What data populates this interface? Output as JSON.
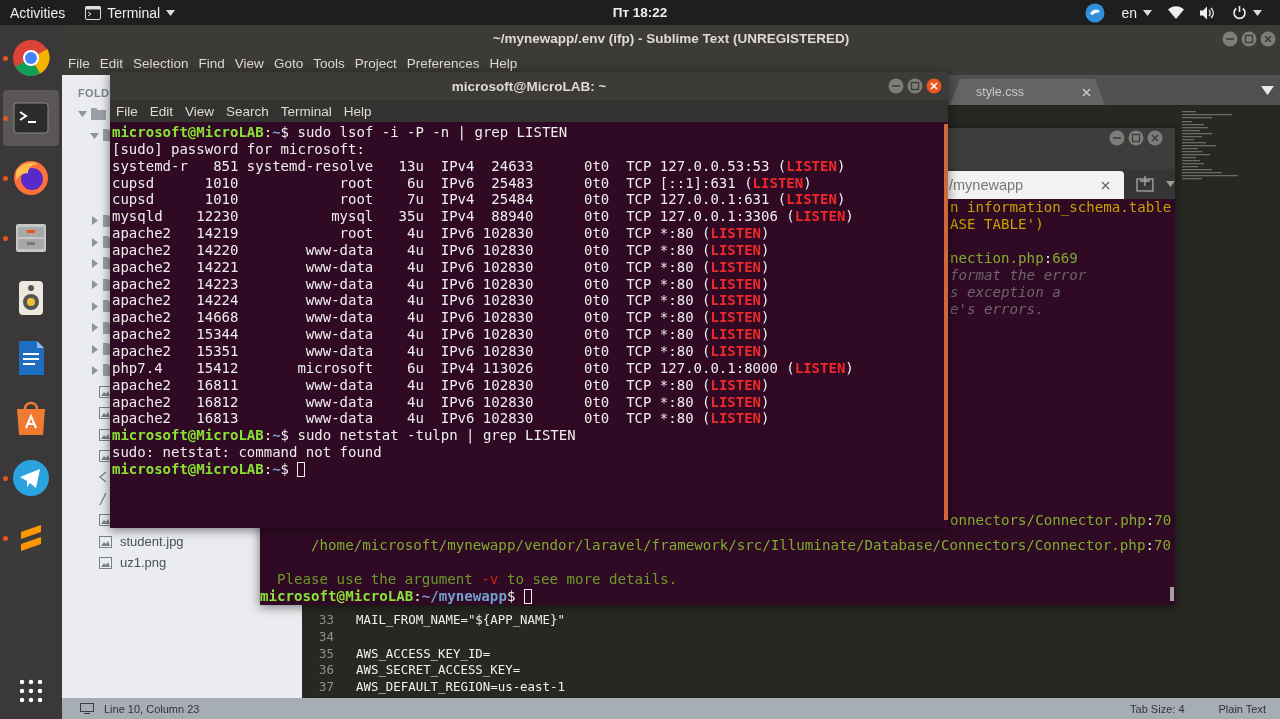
{
  "top_bar": {
    "activities": "Activities",
    "app_menu": "Terminal",
    "clock": "Пт 18:22",
    "keyboard_layout": "en"
  },
  "dock": {
    "items": [
      {
        "kind": "browser",
        "selected": false,
        "running": true
      },
      {
        "kind": "terminal",
        "selected": true,
        "running": true
      },
      {
        "kind": "fox",
        "selected": false,
        "running": true
      },
      {
        "kind": "files",
        "selected": false,
        "running": true
      },
      {
        "kind": "music",
        "selected": false,
        "running": false
      },
      {
        "kind": "document",
        "selected": false,
        "running": false
      },
      {
        "kind": "store",
        "selected": false,
        "running": false
      },
      {
        "kind": "messenger",
        "selected": false,
        "running": true
      },
      {
        "kind": "editor",
        "selected": false,
        "running": true
      }
    ],
    "apps_button": {
      "kind": "apps"
    }
  },
  "editor_window": {
    "title": "~/mynewapp/.env (ifp) - Sublime Text (UNREGISTERED)",
    "menu": [
      "File",
      "Edit",
      "Selection",
      "Find",
      "View",
      "Goto",
      "Tools",
      "Project",
      "Preferences",
      "Help"
    ],
    "sidebar": {
      "header": "FOLD",
      "tree": [
        {
          "kind": "folder",
          "expanded": true,
          "children": [
            {
              "kind": "folder",
              "expanded": true
            },
            {
              "kind": "folder",
              "expanded": false
            },
            {
              "kind": "folder",
              "expanded": false
            },
            {
              "kind": "folder",
              "expanded": false
            },
            {
              "kind": "folder",
              "expanded": false
            },
            {
              "kind": "folder",
              "expanded": false
            },
            {
              "kind": "folder",
              "expanded": false
            },
            {
              "kind": "folder",
              "expanded": false
            },
            {
              "kind": "folder",
              "expanded": false
            },
            {
              "kind": "image"
            },
            {
              "kind": "image"
            },
            {
              "kind": "image"
            },
            {
              "kind": "image"
            },
            {
              "kind": "markup"
            },
            {
              "kind": "script"
            },
            {
              "kind": "image"
            },
            {
              "kind": "image",
              "name": "student.jpg"
            },
            {
              "kind": "image",
              "name": "uz1.png"
            }
          ]
        }
      ]
    },
    "tabs": [
      {
        "label": "style.css",
        "selected": false
      }
    ],
    "lines": [
      {
        "number": "33",
        "text": "MAIL_FROM_NAME=\"${APP_NAME}\""
      },
      {
        "number": "34"
      },
      {
        "number": "35",
        "text": "AWS_ACCESS_KEY_ID="
      },
      {
        "number": "36",
        "text": "AWS_SECRET_ACCESS_KEY="
      },
      {
        "number": "37",
        "text": "AWS_DEFAULT_REGION=us-east-1"
      }
    ],
    "status_bar": {
      "position": "Line 10, Column 23",
      "tab_size": "Tab Size: 4",
      "syntax": "Plain Text"
    }
  },
  "back_terminal": {
    "tab": {
      "label": "/mynewapp"
    },
    "fragment_groups": [
      {
        "lines": [
          {
            "segments": [
              {
                "kind": "string",
                "text": "n information_schema.table"
              }
            ]
          },
          {
            "segments": [
              {
                "kind": "string",
                "text": "ASE TABLE')"
              }
            ]
          }
        ]
      },
      {
        "lines": [
          {
            "segments": [
              {
                "kind": "file",
                "text": "nection.php"
              },
              {
                "kind": "plain",
                "text": ":"
              },
              {
                "kind": "file",
                "text": "669"
              }
            ]
          },
          {
            "segments": [
              {
                "kind": "comment",
                "text": "format the error"
              }
            ]
          },
          {
            "segments": [
              {
                "kind": "comment",
                "text": "s exception a"
              }
            ]
          },
          {
            "segments": [
              {
                "kind": "comment",
                "text": "e's errors."
              }
            ]
          }
        ]
      },
      {
        "lines": [
          {
            "segments": [
              {
                "kind": "file",
                "text": "onnectors/Connector.php"
              },
              {
                "kind": "plain",
                "text": ":"
              },
              {
                "kind": "file",
                "text": "70"
              }
            ]
          }
        ]
      }
    ],
    "lines": [
      {
        "kind": "text",
        "segments": [
          {
            "kind": "file",
            "text": "      /home/microsoft/mynewapp/vendor/laravel/framework/src/Illuminate/Database/Connectors/Connector.php"
          },
          {
            "kind": "plain",
            "text": ":"
          },
          {
            "kind": "file",
            "text": "70"
          }
        ]
      },
      {
        "kind": "blank"
      },
      {
        "kind": "text",
        "segments": [
          {
            "kind": "message",
            "text": "  Please use the argument "
          },
          {
            "kind": "flag",
            "text": "-v"
          },
          {
            "kind": "message",
            "text": " to see more details."
          }
        ]
      },
      {
        "kind": "text",
        "segments": [
          {
            "kind": "user",
            "text": "microsoft@MicroLAB"
          },
          {
            "kind": "plain",
            "text": ":"
          },
          {
            "kind": "path",
            "text": "~/mynewapp"
          },
          {
            "kind": "plain",
            "text": "$ "
          },
          {
            "kind": "cursor"
          }
        ]
      }
    ]
  },
  "terminal": {
    "title": "microsoft@MicroLAB: ~",
    "menu": [
      "File",
      "Edit",
      "View",
      "Search",
      "Terminal",
      "Help"
    ],
    "lines": [
      {
        "segments": [
          {
            "kind": "user",
            "text": "microsoft@MicroLAB"
          },
          {
            "kind": "plain",
            "text": ":"
          },
          {
            "kind": "path",
            "text": "~"
          },
          {
            "kind": "plain",
            "text": "$ sudo lsof -i -P -n | grep LISTEN"
          }
        ]
      },
      {
        "segments": [
          {
            "kind": "plain",
            "text": "[sudo] password for microsoft:"
          }
        ]
      },
      {
        "segments": [
          {
            "kind": "plain",
            "text": "systemd-r   851 systemd-resolve   13u  IPv4  24633      0t0  TCP 127.0.0.53:53 ("
          },
          {
            "kind": "alert",
            "text": "LISTEN"
          },
          {
            "kind": "plain",
            "text": ")"
          }
        ]
      },
      {
        "segments": [
          {
            "kind": "plain",
            "text": "cupsd      1010            root    6u  IPv6  25483      0t0  TCP [::1]:631 ("
          },
          {
            "kind": "alert",
            "text": "LISTEN"
          },
          {
            "kind": "plain",
            "text": ")"
          }
        ]
      },
      {
        "segments": [
          {
            "kind": "plain",
            "text": "cupsd      1010            root    7u  IPv4  25484      0t0  TCP 127.0.0.1:631 ("
          },
          {
            "kind": "alert",
            "text": "LISTEN"
          },
          {
            "kind": "plain",
            "text": ")"
          }
        ]
      },
      {
        "segments": [
          {
            "kind": "plain",
            "text": "mysqld    12230           mysql   35u  IPv4  88940      0t0  TCP 127.0.0.1:3306 ("
          },
          {
            "kind": "alert",
            "text": "LISTEN"
          },
          {
            "kind": "plain",
            "text": ")"
          }
        ]
      },
      {
        "segments": [
          {
            "kind": "plain",
            "text": "apache2   14219            root    4u  IPv6 102830      0t0  TCP *:80 ("
          },
          {
            "kind": "alert",
            "text": "LISTEN"
          },
          {
            "kind": "plain",
            "text": ")"
          }
        ]
      },
      {
        "segments": [
          {
            "kind": "plain",
            "text": "apache2   14220        www-data    4u  IPv6 102830      0t0  TCP *:80 ("
          },
          {
            "kind": "alert",
            "text": "LISTEN"
          },
          {
            "kind": "plain",
            "text": ")"
          }
        ]
      },
      {
        "segments": [
          {
            "kind": "plain",
            "text": "apache2   14221        www-data    4u  IPv6 102830      0t0  TCP *:80 ("
          },
          {
            "kind": "alert",
            "text": "LISTEN"
          },
          {
            "kind": "plain",
            "text": ")"
          }
        ]
      },
      {
        "segments": [
          {
            "kind": "plain",
            "text": "apache2   14223        www-data    4u  IPv6 102830      0t0  TCP *:80 ("
          },
          {
            "kind": "alert",
            "text": "LISTEN"
          },
          {
            "kind": "plain",
            "text": ")"
          }
        ]
      },
      {
        "segments": [
          {
            "kind": "plain",
            "text": "apache2   14224        www-data    4u  IPv6 102830      0t0  TCP *:80 ("
          },
          {
            "kind": "alert",
            "text": "LISTEN"
          },
          {
            "kind": "plain",
            "text": ")"
          }
        ]
      },
      {
        "segments": [
          {
            "kind": "plain",
            "text": "apache2   14668        www-data    4u  IPv6 102830      0t0  TCP *:80 ("
          },
          {
            "kind": "alert",
            "text": "LISTEN"
          },
          {
            "kind": "plain",
            "text": ")"
          }
        ]
      },
      {
        "segments": [
          {
            "kind": "plain",
            "text": "apache2   15344        www-data    4u  IPv6 102830      0t0  TCP *:80 ("
          },
          {
            "kind": "alert",
            "text": "LISTEN"
          },
          {
            "kind": "plain",
            "text": ")"
          }
        ]
      },
      {
        "segments": [
          {
            "kind": "plain",
            "text": "apache2   15351        www-data    4u  IPv6 102830      0t0  TCP *:80 ("
          },
          {
            "kind": "alert",
            "text": "LISTEN"
          },
          {
            "kind": "plain",
            "text": ")"
          }
        ]
      },
      {
        "segments": [
          {
            "kind": "plain",
            "text": "php7.4    15412       microsoft    6u  IPv4 113026      0t0  TCP 127.0.0.1:8000 ("
          },
          {
            "kind": "alert",
            "text": "LISTEN"
          },
          {
            "kind": "plain",
            "text": ")"
          }
        ]
      },
      {
        "segments": [
          {
            "kind": "plain",
            "text": "apache2   16811        www-data    4u  IPv6 102830      0t0  TCP *:80 ("
          },
          {
            "kind": "alert",
            "text": "LISTEN"
          },
          {
            "kind": "plain",
            "text": ")"
          }
        ]
      },
      {
        "segments": [
          {
            "kind": "plain",
            "text": "apache2   16812        www-data    4u  IPv6 102830      0t0  TCP *:80 ("
          },
          {
            "kind": "alert",
            "text": "LISTEN"
          },
          {
            "kind": "plain",
            "text": ")"
          }
        ]
      },
      {
        "segments": [
          {
            "kind": "plain",
            "text": "apache2   16813        www-data    4u  IPv6 102830      0t0  TCP *:80 ("
          },
          {
            "kind": "alert",
            "text": "LISTEN"
          },
          {
            "kind": "plain",
            "text": ")"
          }
        ]
      },
      {
        "segments": [
          {
            "kind": "user",
            "text": "microsoft@MicroLAB"
          },
          {
            "kind": "plain",
            "text": ":"
          },
          {
            "kind": "path",
            "text": "~"
          },
          {
            "kind": "plain",
            "text": "$ sudo netstat -tulpn | grep LISTEN"
          }
        ]
      },
      {
        "segments": [
          {
            "kind": "plain",
            "text": "sudo: netstat: command not found"
          }
        ]
      },
      {
        "segments": [
          {
            "kind": "user",
            "text": "microsoft@MicroLAB"
          },
          {
            "kind": "plain",
            "text": ":"
          },
          {
            "kind": "path",
            "text": "~"
          },
          {
            "kind": "plain",
            "text": "$ "
          },
          {
            "kind": "cursor"
          }
        ]
      }
    ]
  }
}
